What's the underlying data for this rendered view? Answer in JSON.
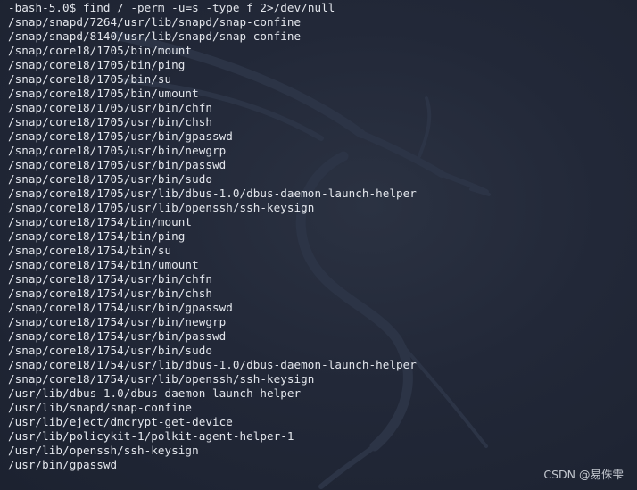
{
  "terminal": {
    "prompt": "-bash-5.0$",
    "command": "find / -perm -u=s -type f 2>/dev/null",
    "output": [
      "/snap/snapd/7264/usr/lib/snapd/snap-confine",
      "/snap/snapd/8140/usr/lib/snapd/snap-confine",
      "/snap/core18/1705/bin/mount",
      "/snap/core18/1705/bin/ping",
      "/snap/core18/1705/bin/su",
      "/snap/core18/1705/bin/umount",
      "/snap/core18/1705/usr/bin/chfn",
      "/snap/core18/1705/usr/bin/chsh",
      "/snap/core18/1705/usr/bin/gpasswd",
      "/snap/core18/1705/usr/bin/newgrp",
      "/snap/core18/1705/usr/bin/passwd",
      "/snap/core18/1705/usr/bin/sudo",
      "/snap/core18/1705/usr/lib/dbus-1.0/dbus-daemon-launch-helper",
      "/snap/core18/1705/usr/lib/openssh/ssh-keysign",
      "/snap/core18/1754/bin/mount",
      "/snap/core18/1754/bin/ping",
      "/snap/core18/1754/bin/su",
      "/snap/core18/1754/bin/umount",
      "/snap/core18/1754/usr/bin/chfn",
      "/snap/core18/1754/usr/bin/chsh",
      "/snap/core18/1754/usr/bin/gpasswd",
      "/snap/core18/1754/usr/bin/newgrp",
      "/snap/core18/1754/usr/bin/passwd",
      "/snap/core18/1754/usr/bin/sudo",
      "/snap/core18/1754/usr/lib/dbus-1.0/dbus-daemon-launch-helper",
      "/snap/core18/1754/usr/lib/openssh/ssh-keysign",
      "/usr/lib/dbus-1.0/dbus-daemon-launch-helper",
      "/usr/lib/snapd/snap-confine",
      "/usr/lib/eject/dmcrypt-get-device",
      "/usr/lib/policykit-1/polkit-agent-helper-1",
      "/usr/lib/openssh/ssh-keysign",
      "/usr/bin/gpasswd"
    ]
  },
  "watermark": "CSDN @易侏雫",
  "colors": {
    "background": "#1f2533",
    "text": "#e3e6ec",
    "logo": "#2c3446"
  },
  "background_icon": "kali-dragon-icon"
}
